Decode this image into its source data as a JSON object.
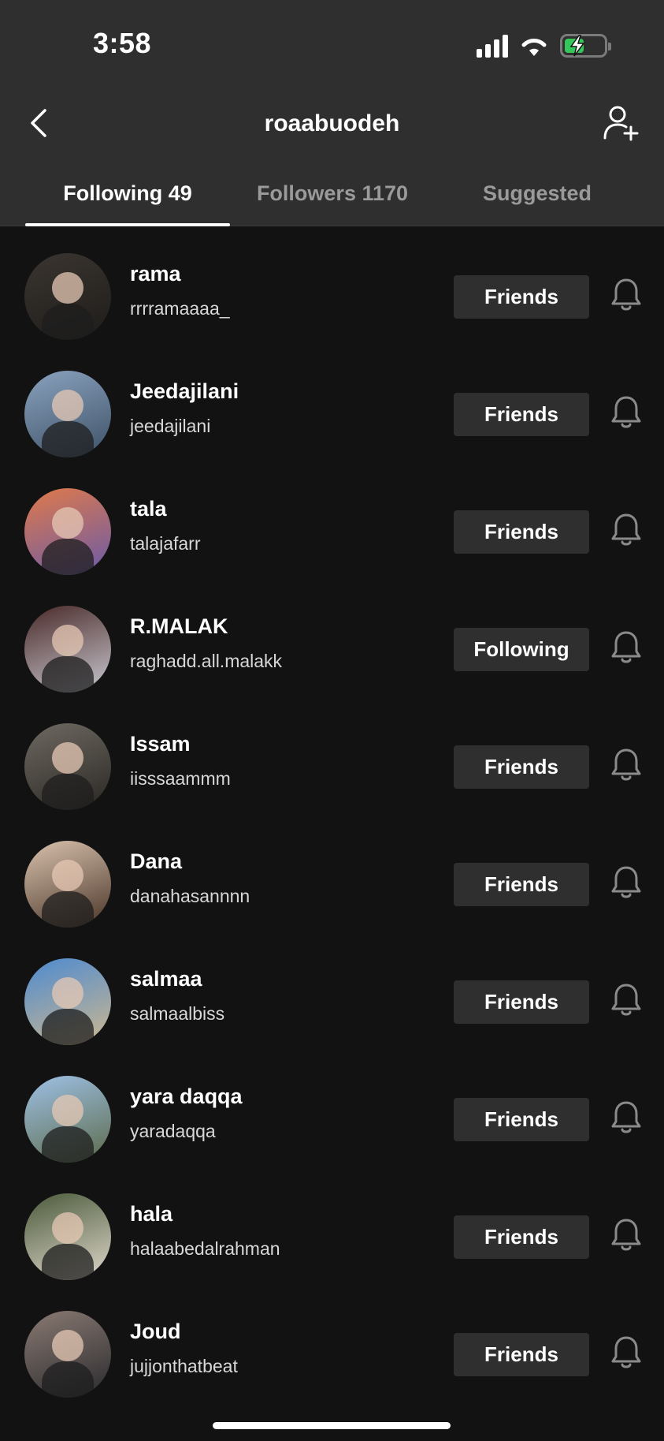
{
  "status_bar": {
    "time": "3:58",
    "icons": [
      "signal-icon",
      "wifi-icon",
      "battery-charging-icon"
    ],
    "battery_color": "#34c759"
  },
  "header": {
    "title": "roaabuodeh",
    "back_icon": "chevron-left-icon",
    "add_icon": "add-user-icon"
  },
  "tabs": [
    {
      "label": "Following 49",
      "active": true
    },
    {
      "label": "Followers 1170",
      "active": false
    },
    {
      "label": "Suggested",
      "active": false
    }
  ],
  "users": [
    {
      "name": "rama",
      "handle": "rrrramaaaa_",
      "button": "Friends",
      "avatar_colors": [
        "#3a3530",
        "#1e1c1a"
      ]
    },
    {
      "name": "Jeedajilani",
      "handle": "jeedajilani",
      "button": "Friends",
      "avatar_colors": [
        "#8aa2bf",
        "#3e5266"
      ]
    },
    {
      "name": "tala",
      "handle": "talajafarr",
      "button": "Friends",
      "avatar_colors": [
        "#e07a4a",
        "#6a5aa8"
      ]
    },
    {
      "name": "R.MALAK",
      "handle": "raghadd.all.malakk",
      "button": "Following",
      "avatar_colors": [
        "#4a2a28",
        "#c8c8d0"
      ]
    },
    {
      "name": "Issam",
      "handle": "iisssaammm",
      "button": "Friends",
      "avatar_colors": [
        "#6e6a62",
        "#2a2622"
      ]
    },
    {
      "name": "Dana",
      "handle": "danahasannnn",
      "button": "Friends",
      "avatar_colors": [
        "#d9c3ae",
        "#4a3428"
      ]
    },
    {
      "name": "salmaa",
      "handle": "salmaalbiss",
      "button": "Friends",
      "avatar_colors": [
        "#4d8ad0",
        "#cdb890"
      ]
    },
    {
      "name": "yara daqqa",
      "handle": "yaradaqqa",
      "button": "Friends",
      "avatar_colors": [
        "#9ec1e6",
        "#5c6a4a"
      ]
    },
    {
      "name": "hala",
      "handle": "halaabedalrahman",
      "button": "Friends",
      "avatar_colors": [
        "#4a5a3a",
        "#e0d8cc"
      ]
    },
    {
      "name": "Joud",
      "handle": "jujjonthatbeat",
      "button": "Friends",
      "avatar_colors": [
        "#8a7a72",
        "#2a2a2e"
      ]
    }
  ]
}
